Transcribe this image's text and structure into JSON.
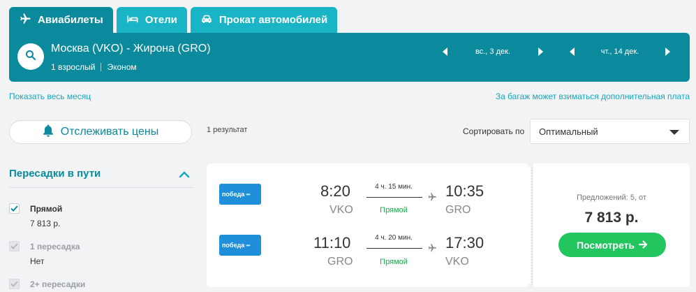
{
  "tabs": [
    {
      "label": "Авиабилеты",
      "icon": "plane-icon",
      "active": true
    },
    {
      "label": "Отели",
      "icon": "bed-icon",
      "active": false
    },
    {
      "label": "Прокат автомобилей",
      "icon": "car-icon",
      "active": false
    }
  ],
  "search": {
    "route": "Москва (VKO) - Жирона (GRO)",
    "passengers": "1 взрослый",
    "cabin": "Эконом",
    "depart_date": "вс., 3 дек.",
    "return_date": "чт., 14 дек."
  },
  "links": {
    "whole_month": "Показать весь месяц",
    "baggage_note": "За багаж может взиматься дополнительная плата"
  },
  "track_prices": "Отслеживать цены",
  "results_count": "1 результат",
  "sort": {
    "label": "Сортировать по",
    "selected": "Оптимальный"
  },
  "filters": {
    "title": "Пересадки в пути",
    "items": [
      {
        "label": "Прямой",
        "sub": "7 813 р.",
        "checked": true,
        "enabled": true
      },
      {
        "label": "1 пересадка",
        "sub": "Нет",
        "checked": true,
        "enabled": false
      },
      {
        "label": "2+ пересадки",
        "sub": "",
        "checked": true,
        "enabled": false
      }
    ]
  },
  "ticket": {
    "legs": [
      {
        "airline": "победа",
        "dep_time": "8:20",
        "dep_code": "VKO",
        "duration": "4 ч. 15 мин.",
        "stops": "Прямой",
        "arr_time": "10:35",
        "arr_code": "GRO"
      },
      {
        "airline": "победа",
        "dep_time": "11:10",
        "dep_code": "GRO",
        "duration": "4 ч. 20 мин.",
        "stops": "Прямой",
        "arr_time": "17:30",
        "arr_code": "VKO"
      }
    ],
    "offers": "Предложений: 5, от",
    "price": "7 813 р.",
    "view_button": "Посмотреть"
  },
  "colors": {
    "brand_dark": "#0a8a9c",
    "brand_light": "#19b4c6",
    "cta_green": "#22c55e",
    "direct_green": "#1aa64d",
    "airline_blue": "#1e8fd8"
  }
}
